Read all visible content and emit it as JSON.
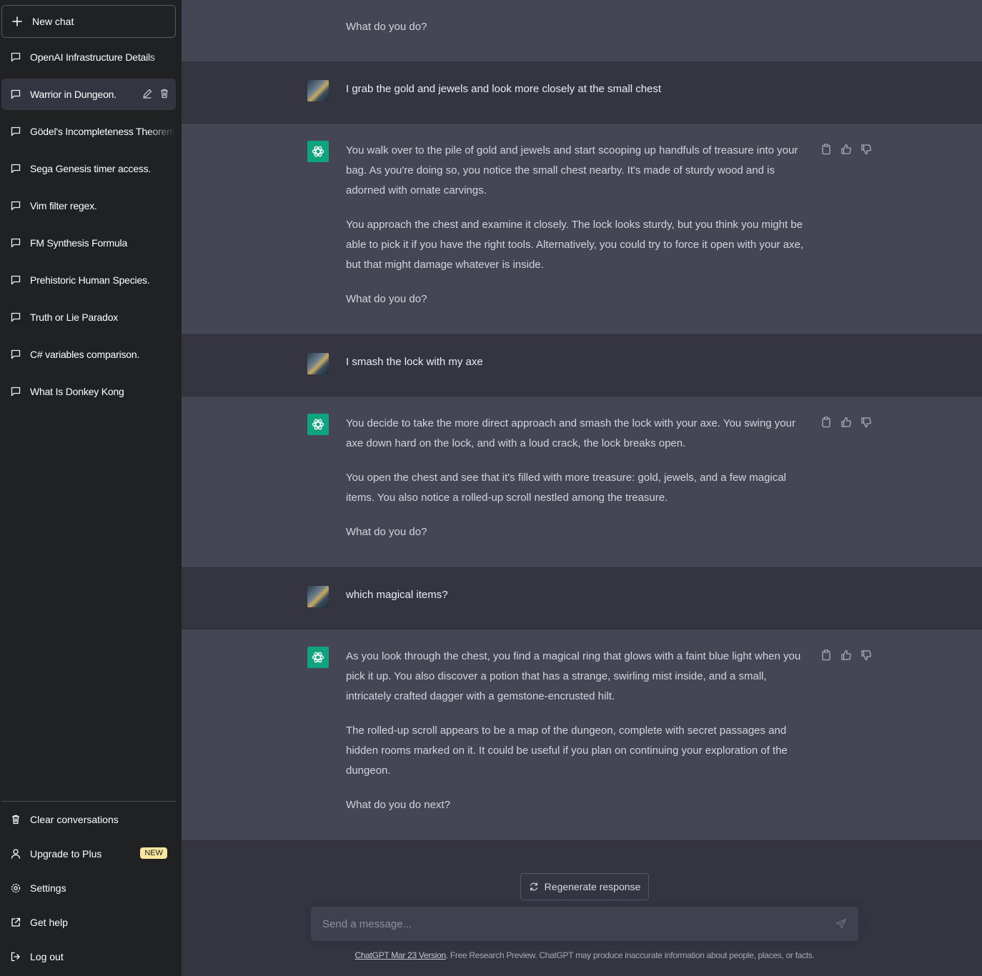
{
  "sidebar": {
    "new_chat_label": "New chat",
    "chats": [
      {
        "label": "OpenAI Infrastructure Details"
      },
      {
        "label": "Warrior in Dungeon.",
        "active": true
      },
      {
        "label": "Gödel's Incompleteness Theorem"
      },
      {
        "label": "Sega Genesis timer access."
      },
      {
        "label": "Vim filter regex."
      },
      {
        "label": "FM Synthesis Formula"
      },
      {
        "label": "Prehistoric Human Species."
      },
      {
        "label": "Truth or Lie Paradox"
      },
      {
        "label": "C# variables comparison."
      },
      {
        "label": "What Is Donkey Kong"
      }
    ],
    "bottom_menu": {
      "clear": "Clear conversations",
      "upgrade": "Upgrade to Plus",
      "upgrade_badge": "NEW",
      "settings": "Settings",
      "help": "Get help",
      "logout": "Log out"
    }
  },
  "conversation": {
    "m0": {
      "paragraphs": [
        "What do you do?"
      ]
    },
    "u1": {
      "text": "I grab the gold and jewels and look more closely at the small chest"
    },
    "b1": {
      "paragraphs": [
        "You walk over to the pile of gold and jewels and start scooping up handfuls of treasure into your bag. As you're doing so, you notice the small chest nearby. It's made of sturdy wood and is adorned with ornate carvings.",
        "You approach the chest and examine it closely. The lock looks sturdy, but you think you might be able to pick it if you have the right tools. Alternatively, you could try to force it open with your axe, but that might damage whatever is inside.",
        "What do you do?"
      ]
    },
    "u2": {
      "text": "I smash the lock with my axe"
    },
    "b2": {
      "paragraphs": [
        "You decide to take the more direct approach and smash the lock with your axe. You swing your axe down hard on the lock, and with a loud crack, the lock breaks open.",
        "You open the chest and see that it's filled with more treasure: gold, jewels, and a few magical items. You also notice a rolled-up scroll nestled among the treasure.",
        "What do you do?"
      ]
    },
    "u3": {
      "text": "which magical items?"
    },
    "b3": {
      "paragraphs": [
        "As you look through the chest, you find a magical ring that glows with a faint blue light when you pick it up. You also discover a potion that has a strange, swirling mist inside, and a small, intricately crafted dagger with a gemstone-encrusted hilt.",
        "The rolled-up scroll appears to be a map of the dungeon, complete with secret passages and hidden rooms marked on it. It could be useful if you plan on continuing your exploration of the dungeon.",
        "What do you do next?"
      ]
    }
  },
  "composer": {
    "regenerate_label": "Regenerate response",
    "placeholder": "Send a message...",
    "footer_link": "ChatGPT Mar 23 Version",
    "footer_text": ". Free Research Preview. ChatGPT may produce inaccurate information about people, places, or facts."
  },
  "colors": {
    "sidebar_bg": "#202123",
    "main_bg": "#343541",
    "bot_bg": "#444654",
    "accent": "#10a37f",
    "badge_bg": "#fae69e"
  }
}
